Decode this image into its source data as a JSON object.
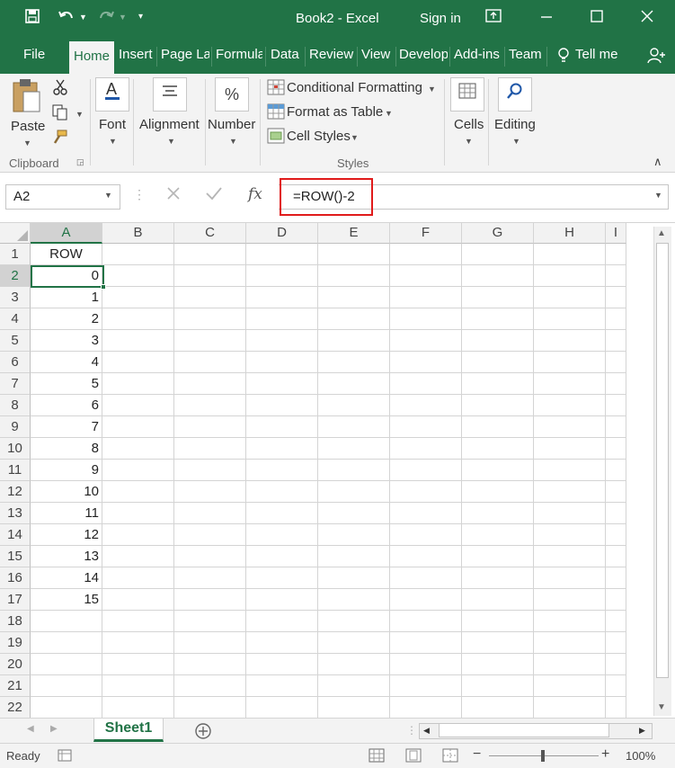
{
  "titlebar": {
    "save_icon": "save-icon",
    "undo_icon": "undo-icon",
    "redo_icon": "redo-icon",
    "customize_icon": "customize-icon",
    "title": "Book2 - Excel",
    "signin": "Sign in",
    "ribbon_display_icon": "ribbon-display-icon",
    "minimize_icon": "minimize-icon",
    "maximize_icon": "maximize-icon",
    "close_icon": "close-icon"
  },
  "tabs": {
    "file": "File",
    "home": "Home",
    "insert": "Insert",
    "page_layout": "Page La",
    "formulas": "Formula",
    "data": "Data",
    "review": "Review",
    "view": "View",
    "developer": "Develop",
    "addins": "Add-ins",
    "team": "Team",
    "tell_me": "Tell me",
    "share_icon": "share-icon"
  },
  "ribbon": {
    "paste": "Paste",
    "clipboard": "Clipboard",
    "font": "Font",
    "alignment": "Alignment",
    "number": "Number",
    "number_symbol": "%",
    "conditional_formatting": "Conditional Formatting",
    "format_as_table": "Format as Table",
    "cell_styles": "Cell Styles",
    "styles": "Styles",
    "cells": "Cells",
    "editing": "Editing"
  },
  "formula_bar": {
    "name_box": "A2",
    "formula": "=ROW()-2",
    "fx": "fx"
  },
  "grid": {
    "columns": [
      "A",
      "B",
      "C",
      "D",
      "E",
      "F",
      "G",
      "H",
      "I"
    ],
    "rows": [
      "1",
      "2",
      "3",
      "4",
      "5",
      "6",
      "7",
      "8",
      "9",
      "10",
      "11",
      "12",
      "13",
      "14",
      "15",
      "16",
      "17",
      "18",
      "19",
      "20",
      "21",
      "22"
    ],
    "a_values": [
      "ROW",
      "0",
      "1",
      "2",
      "3",
      "4",
      "5",
      "6",
      "7",
      "8",
      "9",
      "10",
      "11",
      "12",
      "13",
      "14",
      "15",
      "",
      "",
      "",
      "",
      ""
    ],
    "selected_cell": "A2"
  },
  "sheets": {
    "active": "Sheet1"
  },
  "status": {
    "ready": "Ready",
    "zoom": "100%"
  },
  "colors": {
    "excel_green": "#217346",
    "highlight_red": "#e01b1b"
  }
}
